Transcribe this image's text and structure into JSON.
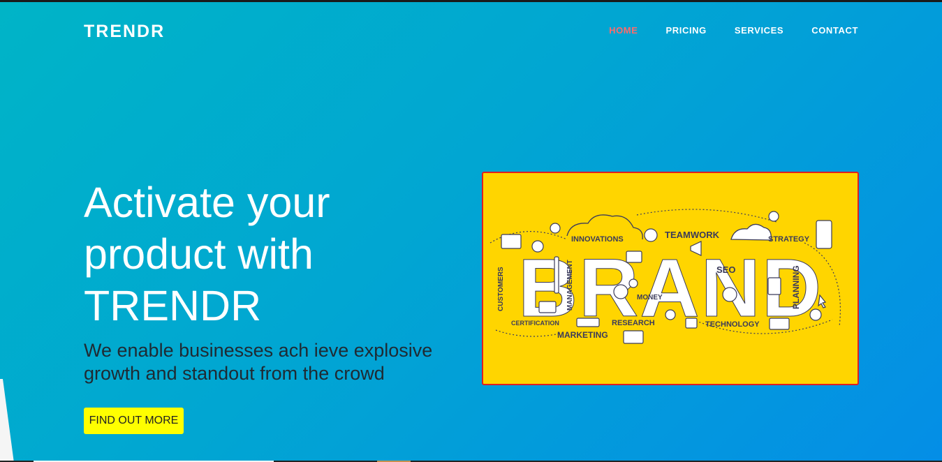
{
  "header": {
    "logo": "TRENDR",
    "nav": [
      {
        "label": "HOME",
        "active": true
      },
      {
        "label": "PRICING",
        "active": false
      },
      {
        "label": "SERVICES",
        "active": false
      },
      {
        "label": "CONTACT",
        "active": false
      }
    ]
  },
  "hero": {
    "headline_lines": [
      "Activate your",
      "product with",
      "TRENDR"
    ],
    "subtitle_lines": [
      "We enable businesses ach ieve explosive",
      "growth and standout from the crowd"
    ],
    "cta_label": "FIND OUT MORE"
  },
  "illustration": {
    "word": "BRAND",
    "labels": {
      "innovations": "INNOVATIONS",
      "teamwork": "TEAMWORK",
      "strategy": "STRATEGY",
      "customers": "CUSTOMERS",
      "management": "MANAGEMENT",
      "seo": "SEO",
      "planning": "PLANNING",
      "money": "MONEY",
      "certification": "CERTIFICATION",
      "research": "RESEARCH",
      "technology": "TECHNOLOGY",
      "marketing": "MARKETING"
    }
  },
  "colors": {
    "gradient_start": "#00b4c7",
    "gradient_end": "#048ee6",
    "nav_active": "#ff6b6b",
    "cta_bg": "#ffff00",
    "card_bg": "#ffd500",
    "card_border": "#e02020"
  }
}
